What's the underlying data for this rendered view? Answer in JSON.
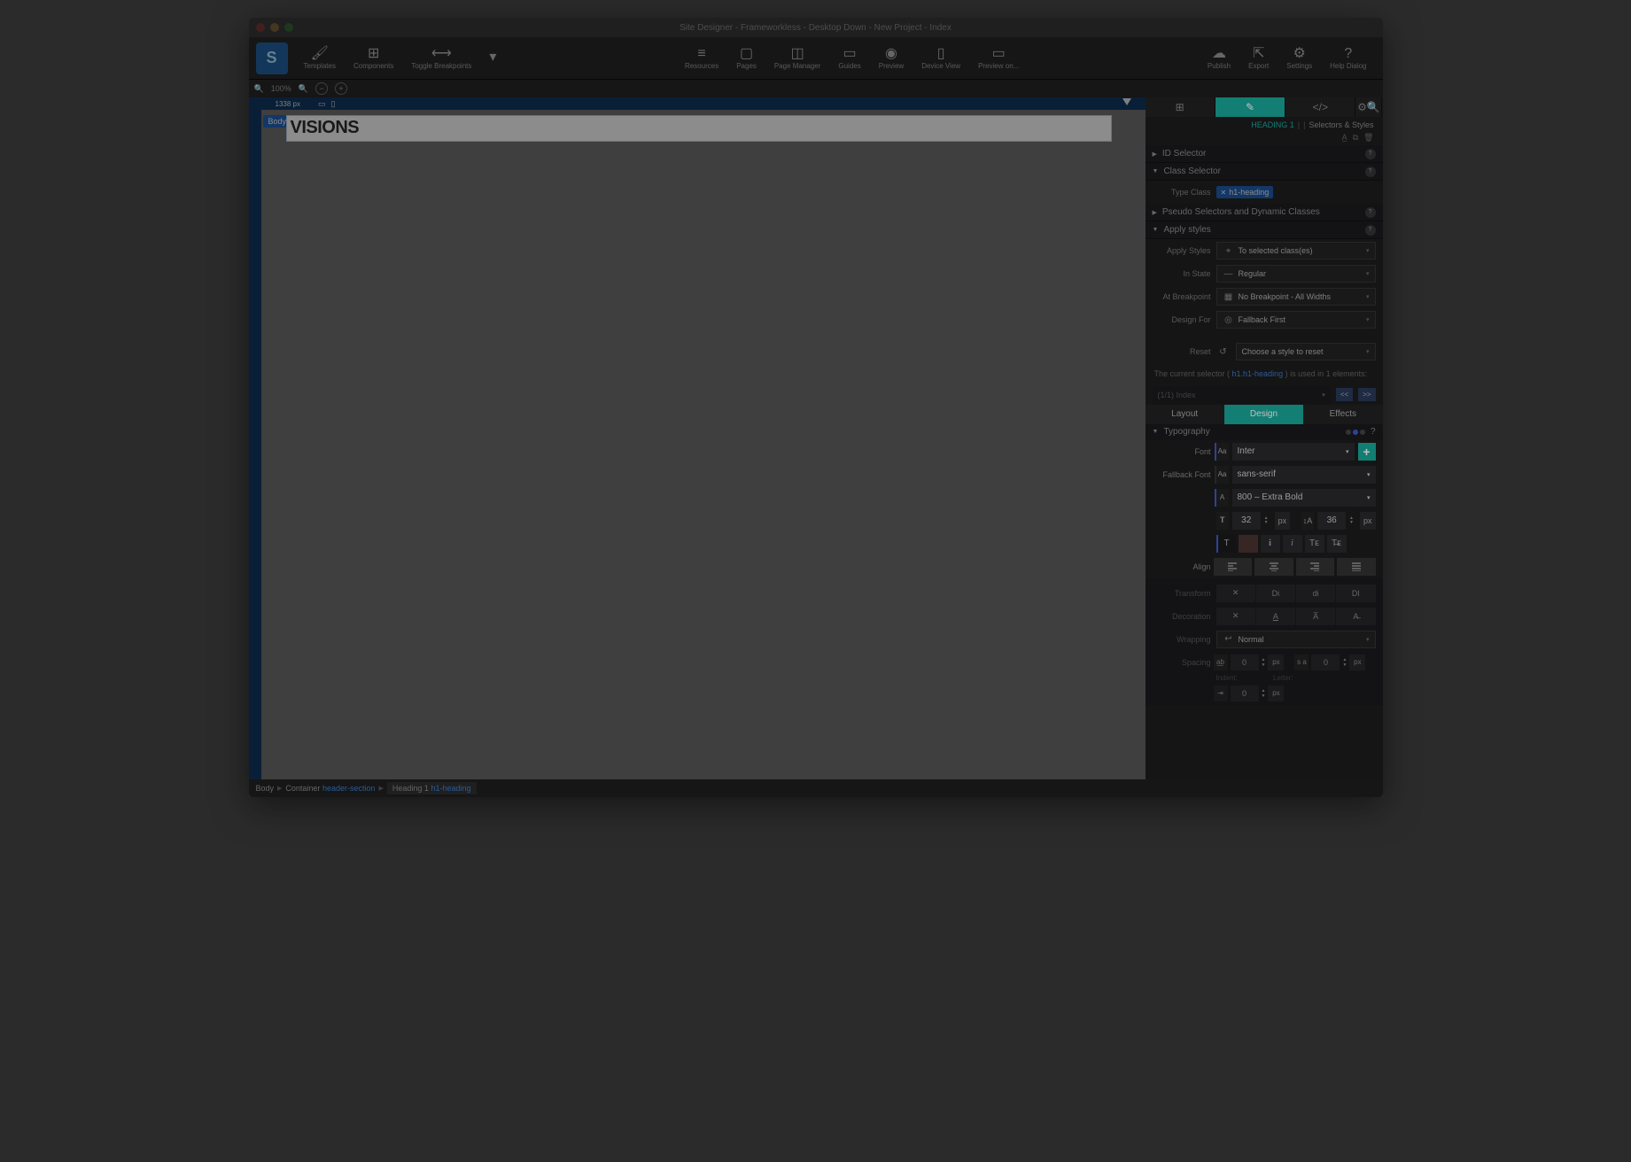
{
  "window": {
    "title": "Site Designer - Frameworkless - Desktop Down - New Project - Index"
  },
  "toolbar": {
    "templates": "Templates",
    "components": "Components",
    "toggle_breakpoints": "Toggle Breakpoints",
    "resources": "Resources",
    "pages": "Pages",
    "page_manager": "Page Manager",
    "guides": "Guides",
    "preview": "Preview",
    "device_view": "Device View",
    "preview_on": "Preview on...",
    "publish": "Publish",
    "export": "Export",
    "settings": "Settings",
    "help_dialog": "Help Dialog"
  },
  "zoom": {
    "level": "100%"
  },
  "ruler": {
    "width": "1338 px"
  },
  "canvas": {
    "body_tag": "Body",
    "heading_text": "VISIONS"
  },
  "breadcrumb": {
    "body": "Body",
    "container": "Container",
    "container_class": "header-section",
    "heading": "Heading 1",
    "heading_class": "h1-heading"
  },
  "rpanel": {
    "crumb_heading": "HEADING 1",
    "crumb_sep": "|",
    "crumb_tail": "Selectors & Styles",
    "id_selector": "ID Selector",
    "class_selector": "Class Selector",
    "type_class": "Type Class",
    "class_chip": "h1-heading",
    "pseudo": "Pseudo Selectors and Dynamic Classes",
    "apply_styles_section": "Apply styles",
    "apply_styles": {
      "label": "Apply Styles",
      "value": "To selected class(es)"
    },
    "in_state": {
      "label": "In State",
      "value": "Regular"
    },
    "at_breakpoint": {
      "label": "At Breakpoint",
      "value": "No Breakpoint - All Widths"
    },
    "design_for": {
      "label": "Design For",
      "value": "Fallback First"
    },
    "reset": {
      "label": "Reset",
      "value": "Choose a style to reset"
    },
    "usage_pre": "The current selector ( ",
    "usage_sel": "h1.h1-heading",
    "usage_post": " ) is used in 1 elements:",
    "usage_item": "(1/1) Index",
    "btn_prev": "<<",
    "btn_next": ">>"
  },
  "ptabs": {
    "layout": "Layout",
    "design": "Design",
    "effects": "Effects"
  },
  "typo": {
    "section": "Typography",
    "font_label": "Font",
    "font_value": "Inter",
    "fallback_label": "Fallback Font",
    "fallback_value": "sans-serif",
    "weight_value": "800 – Extra Bold",
    "size_value": "32",
    "size_unit": "px",
    "lineheight_value": "36",
    "lineheight_unit": "px",
    "align_label": "Align",
    "transform_label": "Transform",
    "transform_opts": [
      "✕",
      "Di",
      "di",
      "DI"
    ],
    "decoration_label": "Decoration",
    "wrapping_label": "Wrapping",
    "wrapping_value": "Normal",
    "spacing_label": "Spacing",
    "spacing_val": "0",
    "spacing_unit": "px",
    "indent_lbl": "Indent:",
    "letter_lbl": "Letter:",
    "indent_val": "0",
    "indent_unit": "px"
  }
}
